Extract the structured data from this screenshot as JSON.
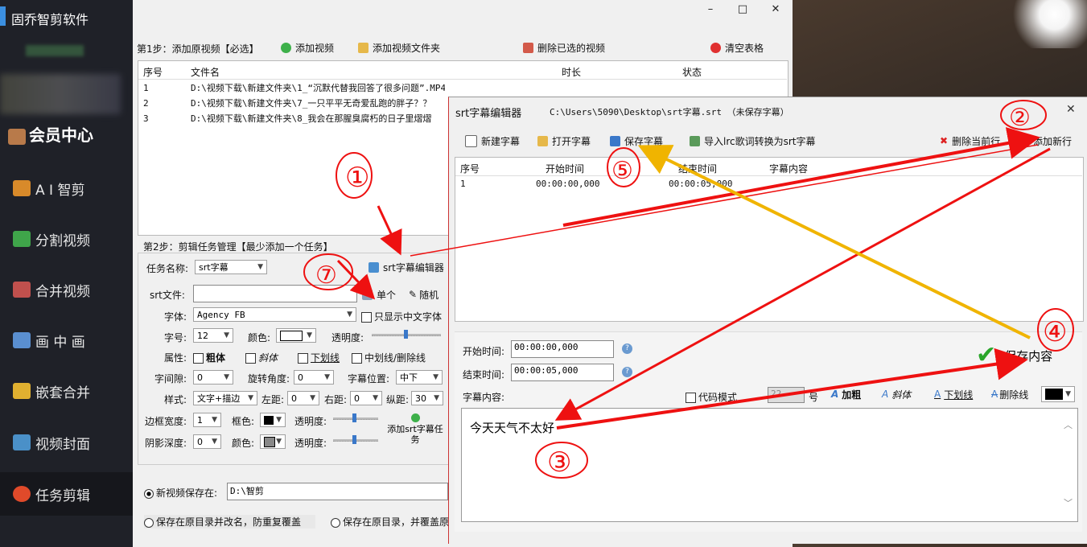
{
  "app": {
    "title": "固乔智剪软件",
    "vip_label": "会员中心"
  },
  "sidebar": {
    "items": [
      {
        "label": "A I 智剪",
        "icon": "ai-icon",
        "color": "#d88a2a"
      },
      {
        "label": "分割视频",
        "icon": "split-icon",
        "color": "#3fa54a"
      },
      {
        "label": "合并视频",
        "icon": "merge-icon",
        "color": "#c0504d"
      },
      {
        "label": "画 中 画",
        "icon": "pip-icon",
        "color": "#5a8fd0"
      },
      {
        "label": "嵌套合并",
        "icon": "nest-icon",
        "color": "#e0b030"
      },
      {
        "label": "视频封面",
        "icon": "cover-icon",
        "color": "#4a90c8"
      },
      {
        "label": "任务剪辑",
        "icon": "task-icon",
        "color": "#e04a2a"
      }
    ]
  },
  "step1": {
    "label": "第1步：添加原视频【必选】",
    "add_video": "添加视频",
    "add_folder": "添加视频文件夹",
    "delete_selected": "删除已选的视频",
    "clear_table": "清空表格",
    "columns": [
      "序号",
      "文件名",
      "时长",
      "状态"
    ],
    "rows": [
      {
        "no": "1",
        "file": "D:\\视频下载\\新建文件夹\\1_“沉默代替我回答了很多问题”.MP4"
      },
      {
        "no": "2",
        "file": "D:\\视频下载\\新建文件夹\\7_一只平平无奇爱乱跑的胖子？？"
      },
      {
        "no": "3",
        "file": "D:\\视频下载\\新建文件夹\\8_我会在那腥臭腐朽的日子里熠熠"
      }
    ]
  },
  "step2": {
    "label": "第2步：剪辑任务管理【最少添加一个任务】",
    "task_name_label": "任务名称:",
    "task_name_value": "srt字幕",
    "srt_editor_btn": "srt字幕编辑器",
    "srt_file_label": "srt文件:",
    "srt_file_value": "",
    "single_btn": "单个",
    "random_btn": "随机",
    "font_label": "字体:",
    "font_value": "Agency FB",
    "only_chinese": "只显示中文字体",
    "size_label": "字号:",
    "size_value": "12",
    "color_label": "颜色:",
    "opacity_label": "透明度:",
    "attr_label": "属性:",
    "bold": "粗体",
    "italic": "斜体",
    "underline": "下划线",
    "strike": "中划线/删除线",
    "spacing_label": "字间隙:",
    "spacing_value": "0",
    "rotate_label": "旋转角度:",
    "rotate_value": "0",
    "position_label": "字幕位置:",
    "position_value": "中下",
    "style_label": "样式:",
    "style_value": "文字+描边",
    "left_label": "左距:",
    "left_value": "0",
    "right_label": "右距:",
    "right_value": "0",
    "vert_label": "纵距:",
    "vert_value": "30",
    "border_label": "边框宽度:",
    "border_value": "1",
    "frame_color_label": "框色:",
    "opacity2_label": "透明度:",
    "shadow_label": "阴影深度:",
    "shadow_value": "0",
    "shadow_color_label": "颜色:",
    "opacity3_label": "透明度:",
    "add_task_btn": "添加srt字幕任务",
    "save_new_label": "新视频保存在:",
    "save_new_value": "D:\\智剪",
    "save_rename": "保存在原目录并改名，防重复覆盖",
    "save_overwrite": "保存在原目录，并覆盖原"
  },
  "srt_editor": {
    "title": "srt字幕编辑器",
    "path": "C:\\Users\\5090\\Desktop\\srt字幕.srt （未保存字幕）",
    "new_sub": "新建字幕",
    "open_sub": "打开字幕",
    "save_sub": "保存字幕",
    "import_lrc": "导入lrc歌词转换为srt字幕",
    "delete_row": "删除当前行",
    "add_row": "添加新行",
    "columns": [
      "序号",
      "开始时间",
      "结束时间",
      "字幕内容"
    ],
    "rows": [
      {
        "no": "1",
        "start": "00:00:00,000",
        "end": "00:00:05,000",
        "text": ""
      }
    ],
    "start_label": "开始时间:",
    "start_value": "00:00:00,000",
    "end_label": "结束时间:",
    "end_value": "00:00:05,000",
    "content_label": "字幕内容:",
    "code_mode": "代码模式",
    "size_value": "22",
    "size_unit": "号",
    "bold": "加粗",
    "italic": "斜体",
    "underline": "下划线",
    "strike": "删除线",
    "save_content": "保存内容",
    "content_text": "今天天气不太好"
  },
  "annotations": {
    "n1": "①",
    "n2": "②",
    "n3": "③",
    "n4": "④",
    "n5": "⑤",
    "n7": "⑦"
  },
  "colors": {
    "red": "#e11",
    "orange": "#f0b400",
    "sidebar_bg": "#1f2128",
    "window_bg": "#f0f0f0"
  }
}
